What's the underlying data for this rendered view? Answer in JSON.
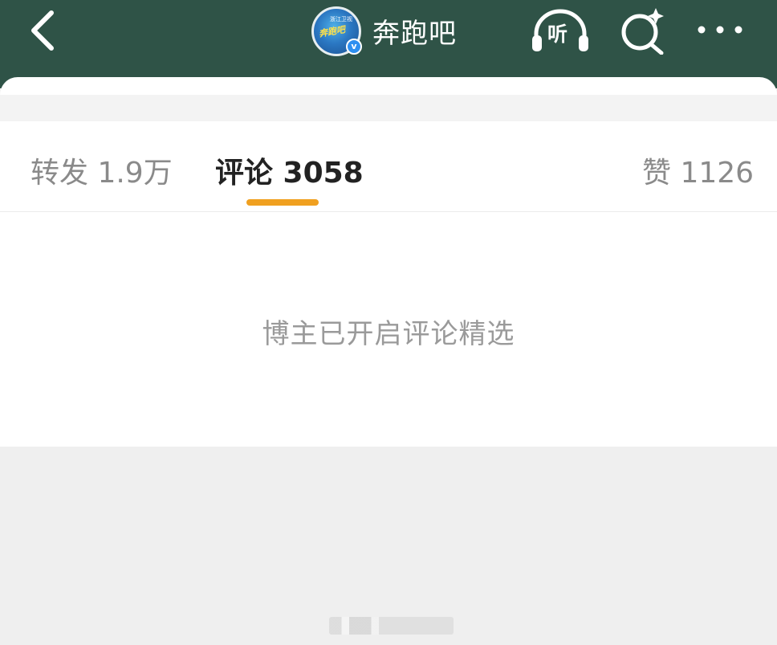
{
  "header": {
    "account_name": "奔跑吧",
    "listen_label": "听",
    "avatar_subtext": "浙江卫视",
    "avatar_text": "奔跑吧",
    "verified_mark": "v"
  },
  "tabs": [
    {
      "label": "转发 1.9万",
      "active": false
    },
    {
      "label": "评论 3058",
      "active": true
    },
    {
      "label": "赞 1126",
      "active": false
    }
  ],
  "notice": "博主已开启评论精选",
  "colors": {
    "header_bg": "#2f5347",
    "active_indicator": "#f0a020",
    "inactive_tab": "#8a8a8a",
    "active_tab": "#222222"
  }
}
